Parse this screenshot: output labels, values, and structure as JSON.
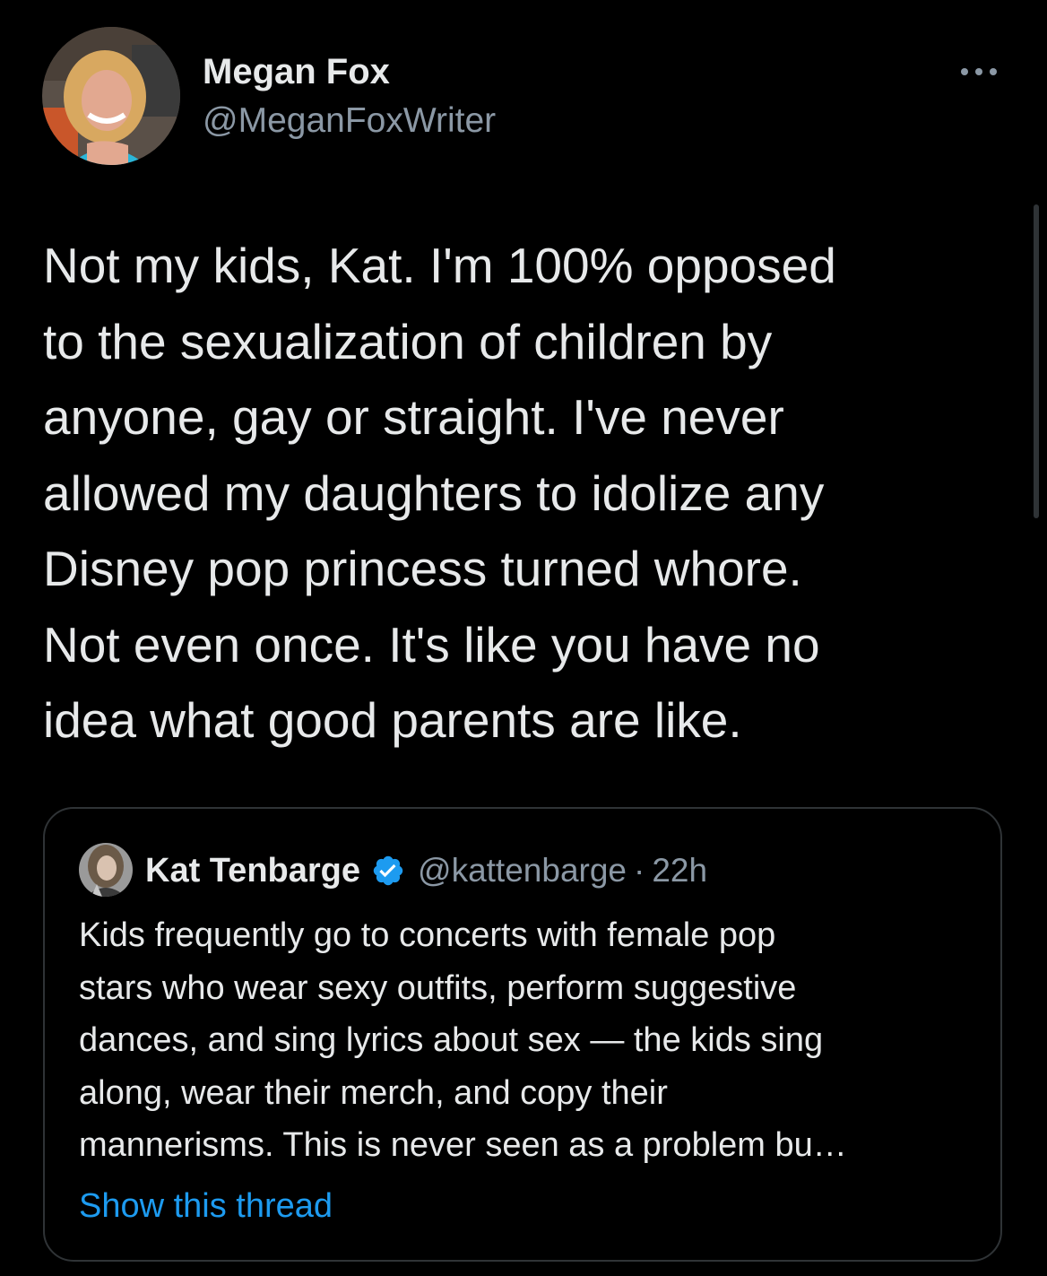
{
  "tweet": {
    "author": {
      "display_name": "Megan Fox",
      "handle": "@MeganFoxWriter",
      "avatar_icon": "profile-photo"
    },
    "more_icon": "more-dots-icon",
    "text_lines": [
      "Not my kids, Kat. I'm 100% opposed",
      "to the sexualization of children by",
      "anyone, gay or straight. I've never",
      "allowed my daughters to idolize any",
      "Disney pop princess turned whore.",
      "Not even once. It's like you have no",
      "idea what good parents are like."
    ]
  },
  "quoted_tweet": {
    "author": {
      "display_name": "Kat Tenbarge",
      "verified_icon": "verified-badge-icon",
      "handle": "@kattenbarge",
      "separator": "·",
      "time": "22h"
    },
    "text_lines": [
      "Kids frequently go to concerts with female pop",
      "stars who wear sexy outfits, perform suggestive",
      "dances, and sing lyrics about sex — the kids sing",
      "along, wear their merch, and copy their",
      "mannerisms. This is never seen as a problem bu…"
    ],
    "show_thread_label": "Show this thread"
  },
  "colors": {
    "background": "#000000",
    "text_primary": "#e7e9ea",
    "text_secondary": "#8b98a5",
    "link": "#1d9bf0",
    "border": "#2f3336"
  }
}
